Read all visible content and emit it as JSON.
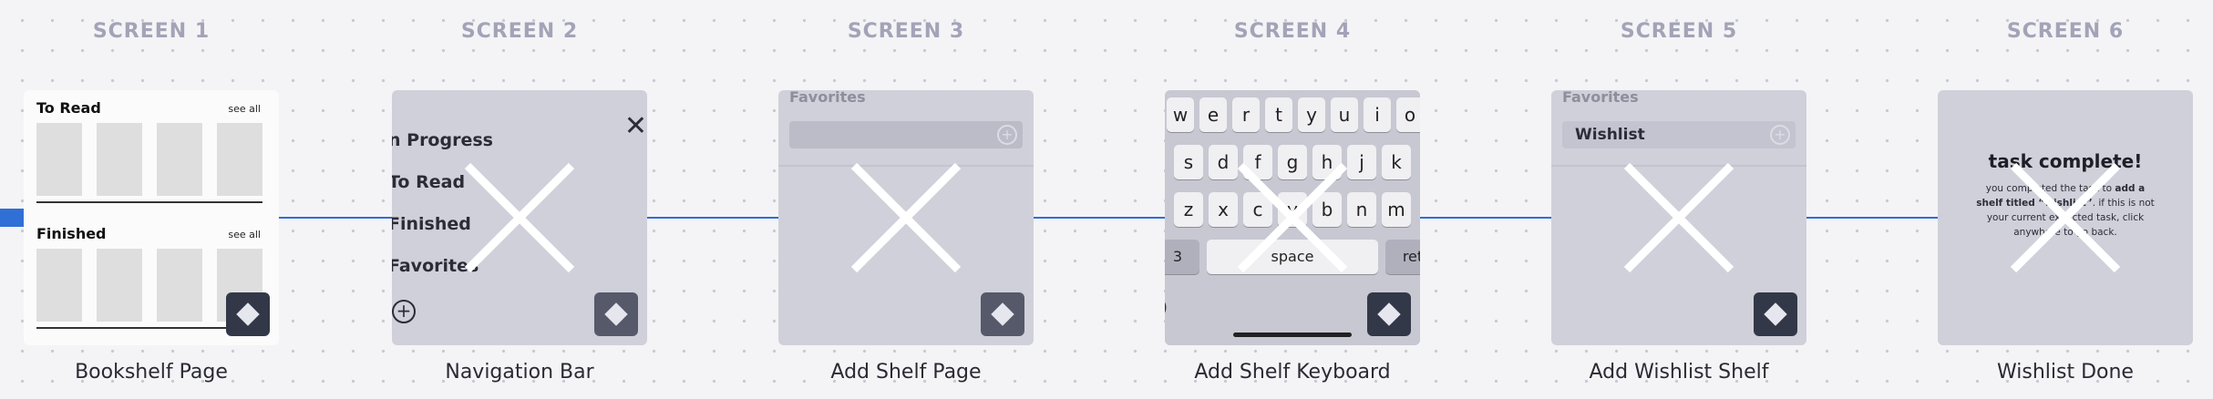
{
  "screens": [
    {
      "heading": "SCREEN 1",
      "caption": "Bookshelf Page"
    },
    {
      "heading": "SCREEN 2",
      "caption": "Navigation Bar"
    },
    {
      "heading": "SCREEN 3",
      "caption": "Add Shelf Page"
    },
    {
      "heading": "SCREEN 4",
      "caption": "Add Shelf Keyboard"
    },
    {
      "heading": "SCREEN 5",
      "caption": "Add Wishlist Shelf"
    },
    {
      "heading": "SCREEN 6",
      "caption": "Wishlist Done"
    }
  ],
  "bookshelf": {
    "shelf1_title": "To Read",
    "shelf2_title": "Finished",
    "see_all": "see all"
  },
  "nav": {
    "items": [
      "n Progress",
      "To Read",
      "Finished",
      "Favorites"
    ],
    "close_glyph": "✕",
    "add_glyph": "+"
  },
  "add_shelf": {
    "label": "Favorites",
    "wishlist_value": "Wishlist"
  },
  "keyboard": {
    "row1": [
      "w",
      "e",
      "r",
      "t",
      "y",
      "u",
      "i",
      "o"
    ],
    "row2": [
      "s",
      "d",
      "f",
      "g",
      "h",
      "j",
      "k"
    ],
    "row3": [
      "z",
      "x",
      "c",
      "v",
      "b",
      "n",
      "m"
    ],
    "num_key": "3",
    "space_key": "space",
    "return_key": "ret",
    "paren": ")"
  },
  "done": {
    "title": "task complete!",
    "body_1": "you completed the task to ",
    "body_bold": "add a shelf titled “wishlist”",
    "body_2": ". if this is not your current expected task, click anywhere to go back."
  },
  "colors": {
    "connector": "#2f6fd6",
    "heading": "#a3a3b8",
    "frame_gray": "#d0d0da"
  }
}
